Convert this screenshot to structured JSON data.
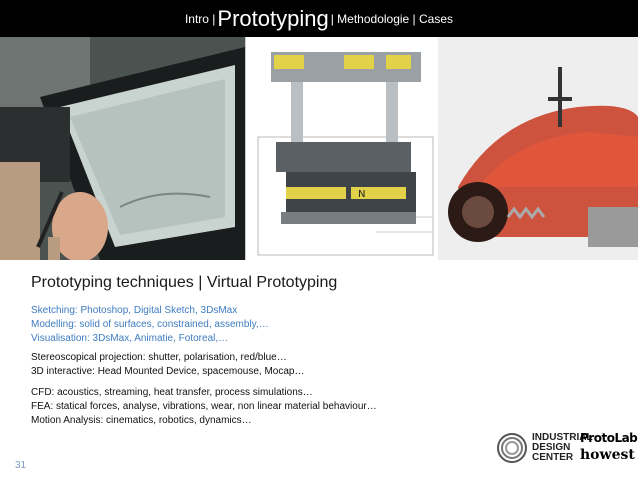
{
  "nav": {
    "intro": "Intro |",
    "current": "Prototyping",
    "rest": "| Methodologie | Cases"
  },
  "heading": "Prototyping techniques | Virtual Prototyping",
  "blue_lines": [
    "Sketching: Photoshop, Digital Sketch, 3DsMax",
    "Modelling: solid of surfaces, constrained, assembly,…",
    "Visualisation: 3DsMax, Animatie, Fotoreal,…"
  ],
  "black_lines_1": [
    "Stereoscopical projection: shutter, polarisation, red/blue…",
    "3D interactive: Head Mounted Device, spacemouse, Mocap…"
  ],
  "black_lines_2": [
    "CFD: acoustics, streaming, heat transfer, process simulations…",
    "FEA: statical forces, analyse, vibrations, wear, non linear material behaviour…",
    "Motion Analysis: cinematics, robotics, dynamics…"
  ],
  "page_number": "31",
  "logos": {
    "idc": [
      "INDUSTRIAL",
      "DESIGN",
      "CENTER"
    ],
    "protolab": "ProtoLab",
    "howest": "howest"
  },
  "colors": {
    "bar": "#000000",
    "blue_text": "#3e7cc0"
  }
}
